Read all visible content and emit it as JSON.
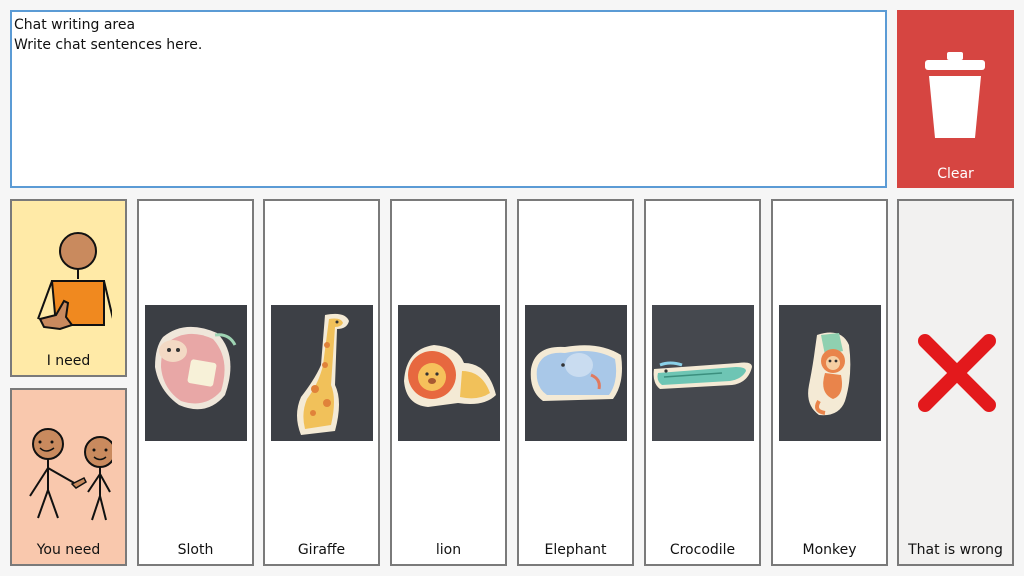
{
  "chat": {
    "title": "Chat writing area",
    "placeholder": "Write chat sentences here."
  },
  "clear": {
    "label": "Clear",
    "icon": "trash-icon",
    "color": "#d64541"
  },
  "tiles": [
    {
      "id": "i-need",
      "label": "I need",
      "icon": "person-self-icon",
      "color": "#ffeaa7"
    },
    {
      "id": "you-need",
      "label": "You need",
      "icon": "person-pointing-icon",
      "color": "#f9c8ad"
    },
    {
      "id": "sloth",
      "label": "Sloth",
      "icon": "sloth-photo"
    },
    {
      "id": "giraffe",
      "label": "Giraffe",
      "icon": "giraffe-photo"
    },
    {
      "id": "lion",
      "label": "lion",
      "icon": "lion-photo"
    },
    {
      "id": "elephant",
      "label": "Elephant",
      "icon": "elephant-photo"
    },
    {
      "id": "crocodile",
      "label": "Crocodile",
      "icon": "crocodile-photo"
    },
    {
      "id": "monkey",
      "label": "Monkey",
      "icon": "monkey-photo"
    },
    {
      "id": "that-is-wrong",
      "label": "That is wrong",
      "icon": "red-x-icon",
      "color": "#e3191c"
    }
  ]
}
